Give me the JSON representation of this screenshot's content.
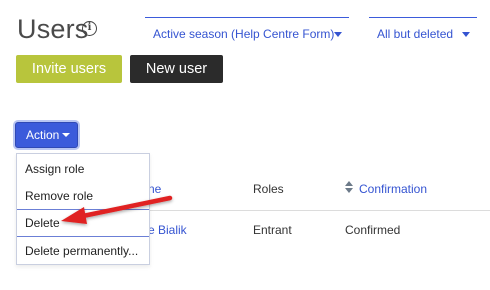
{
  "page": {
    "title": "Users"
  },
  "filters": {
    "season": "Active season (Help Centre Form)",
    "status": "All but deleted"
  },
  "buttons": {
    "invite": "Invite users",
    "new_user": "New user",
    "action": "Action"
  },
  "action_menu": {
    "items": [
      "Assign role",
      "Remove role",
      "Delete",
      "Delete permanently..."
    ],
    "highlighted": "Delete"
  },
  "table": {
    "headers": {
      "name": "ne",
      "roles": "Roles",
      "confirmation": "Confirmation"
    },
    "rows": [
      {
        "name": "e Bialik",
        "role": "Entrant",
        "status": "Confirmed"
      }
    ]
  },
  "colors": {
    "accent": "#3b5bdb",
    "invite_button": "#b8c53c",
    "new_user_button": "#2b2b2b",
    "annotation_arrow": "#e02020"
  },
  "icons": {
    "info": "info-icon",
    "sort": "sort-icon",
    "dropdown": "chevron-down-icon",
    "annotation": "arrow-pointer-icon"
  }
}
